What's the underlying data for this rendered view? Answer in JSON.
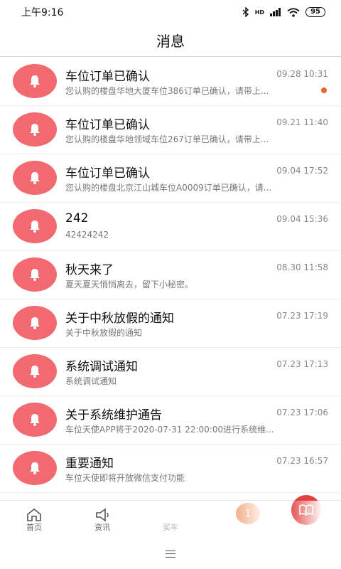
{
  "status_bar": {
    "time": "上午9:16",
    "battery": "95",
    "network_label": "HD"
  },
  "header": {
    "title": "消息"
  },
  "messages": [
    {
      "title": "车位订单已确认",
      "time": "09.28 10:31",
      "preview": "您认购的楼盘华地大厦车位386订单已确认，请带上...",
      "unread": true
    },
    {
      "title": "车位订单已确认",
      "time": "09.21 11:40",
      "preview": "您认购的楼盘华地领域车位267订单已确认，请带上...",
      "unread": false
    },
    {
      "title": "车位订单已确认",
      "time": "09.04 17:52",
      "preview": "您认购的楼盘北京江山城车位A0009订单已确认，请...",
      "unread": false
    },
    {
      "title": "242",
      "time": "09.04 15:36",
      "preview": "42424242",
      "unread": false
    },
    {
      "title": "秋天来了",
      "time": "08.30 11:58",
      "preview": "夏天夏天悄悄离去，留下小秘密。",
      "unread": false
    },
    {
      "title": "关于中秋放假的通知",
      "time": "07.23 17:19",
      "preview": "关于中秋放假的通知",
      "unread": false
    },
    {
      "title": "系统调试通知",
      "time": "07.23 17:13",
      "preview": "系统调试通知",
      "unread": false
    },
    {
      "title": "关于系统维护通告",
      "time": "07.23 17:06",
      "preview": "车位天使APP将于2020-07-31 22:00:00进行系统维...",
      "unread": false
    },
    {
      "title": "重要通知",
      "time": "07.23 16:57",
      "preview": "车位天使即将开放微信支付功能",
      "unread": false
    }
  ],
  "tab_bar": {
    "tabs": [
      {
        "label": "首页",
        "icon": "home-icon"
      },
      {
        "label": "资讯",
        "icon": "megaphone-icon"
      },
      {
        "label": "买车",
        "icon": "book-icon"
      },
      {
        "label": "",
        "icon": "message-icon"
      },
      {
        "label": "",
        "icon": "user-icon"
      }
    ],
    "badge_count": "1"
  },
  "colors": {
    "avatar": "#f26a6f",
    "unread_dot": "#e8672b",
    "center_button": "#e0413e",
    "badge": "#ea6f2c"
  }
}
